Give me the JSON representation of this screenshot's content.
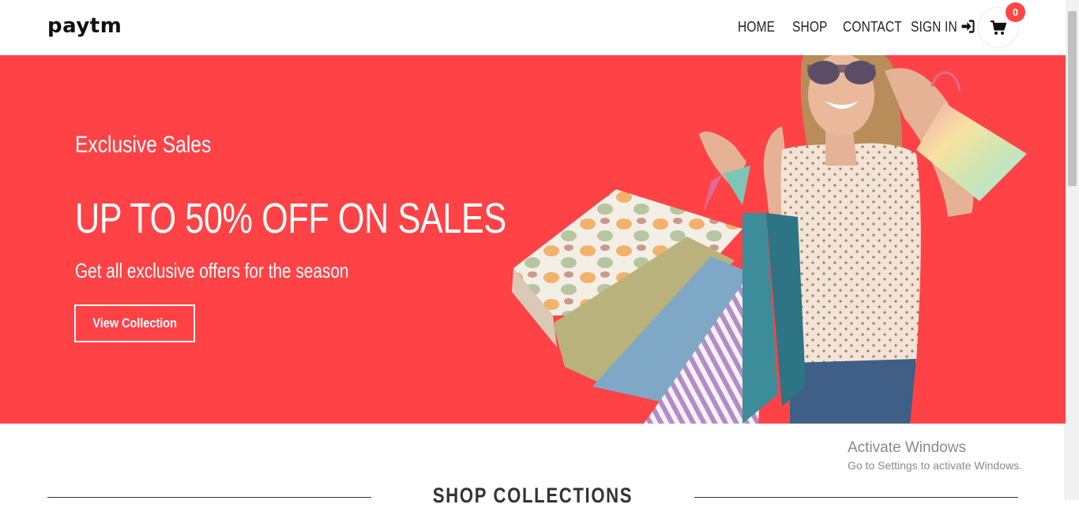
{
  "brand": {
    "logo_text": "paytm"
  },
  "nav": {
    "items": [
      {
        "label": "HOME"
      },
      {
        "label": "SHOP"
      },
      {
        "label": "CONTACT"
      },
      {
        "label": "SIGN IN"
      }
    ],
    "signin_icon": "sign-in-icon",
    "cart_icon": "shopping-cart-icon",
    "cart_count": "0"
  },
  "hero": {
    "eyebrow": "Exclusive Sales",
    "headline": "UP TO 50% OFF ON SALES",
    "subtext": "Get all exclusive offers for the season",
    "cta_label": "View Collection",
    "background_color": "#ff4245"
  },
  "section": {
    "title": "SHOP COLLECTIONS"
  },
  "os_overlay": {
    "line1": "Activate Windows",
    "line2": "Go to Settings to activate Windows."
  },
  "colors": {
    "accent": "#ff4245",
    "badge": "#ff4545",
    "text": "#222222"
  }
}
